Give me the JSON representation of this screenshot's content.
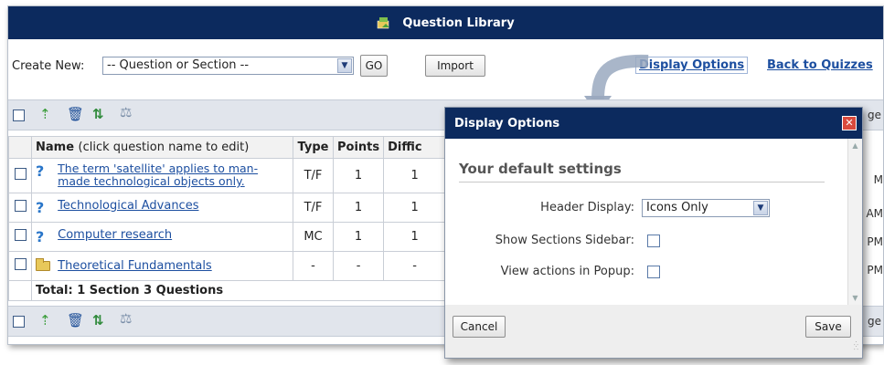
{
  "window": {
    "title": "Question Library"
  },
  "create_row": {
    "label": "Create New:",
    "select_value": "-- Question or Section --",
    "go_label": "GO",
    "import_label": "Import",
    "display_options_link": "Display Options",
    "back_link": "Back to Quizzes"
  },
  "toolbar": {
    "icons": [
      "add-icon",
      "delete-icon",
      "reorder-icon",
      "scales-icon"
    ],
    "clipped_text": "ge"
  },
  "table": {
    "headers": {
      "name_bold": "Name",
      "name_hint": "(click question name to edit)",
      "type": "Type",
      "points": "Points",
      "difficulty_clipped": "Diffic"
    },
    "rows": [
      {
        "name": "The term 'satellite' applies to man-made technological objects only.",
        "type": "T/F",
        "points": "1",
        "difficulty": "1",
        "clipped": "M"
      },
      {
        "name": "Technological Advances",
        "type": "T/F",
        "points": "1",
        "difficulty": "1",
        "clipped": "AM"
      },
      {
        "name": "Computer research",
        "type": "MC",
        "points": "1",
        "difficulty": "1",
        "clipped": "PM"
      },
      {
        "name": "Theoretical Fundamentals",
        "type": "-",
        "points": "-",
        "difficulty": "-",
        "clipped": "PM"
      }
    ],
    "total": "Total: 1 Section 3 Questions"
  },
  "dialog": {
    "title": "Display Options",
    "heading": "Your default settings",
    "header_display_label": "Header Display:",
    "header_display_value": "Icons Only",
    "show_sections_label": "Show Sections Sidebar:",
    "view_actions_label": "View actions in Popup:",
    "cancel_label": "Cancel",
    "save_label": "Save"
  },
  "colors": {
    "title_bg": "#0c2a5e",
    "link": "#1d4fa0",
    "toolbar_bg": "#e1e5ec"
  }
}
